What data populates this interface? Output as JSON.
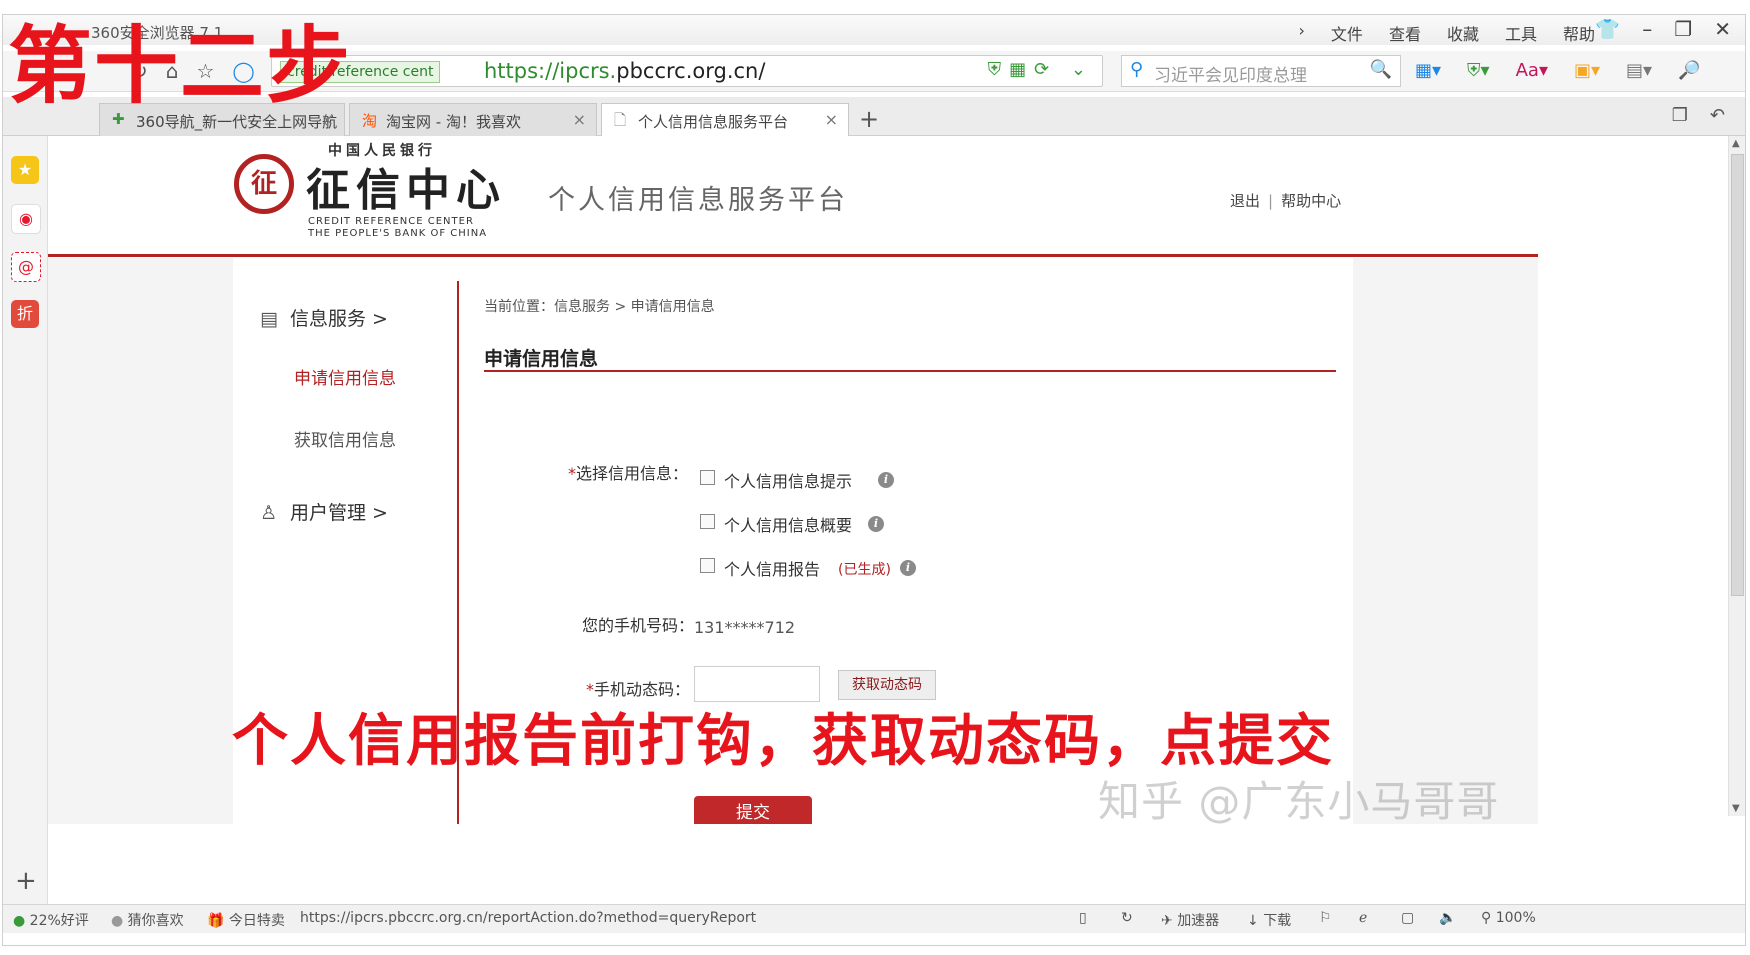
{
  "browser": {
    "app_title": "360安全浏览器 7.1",
    "menu": [
      "文件",
      "查看",
      "收藏",
      "工具",
      "帮助"
    ],
    "site_badge": "credit reference cent",
    "url_scheme": "https://ipcrs.",
    "url_host": "pbccrc.org.cn/",
    "search_placeholder": "习近平会见印度总理",
    "tabs": [
      {
        "label": "360导航_新一代安全上网导航",
        "active": false
      },
      {
        "label": "淘宝网 - 淘！我喜欢",
        "active": false
      },
      {
        "label": "个人信用信息服务平台",
        "active": true
      }
    ],
    "status": {
      "rating": "22%好评",
      "guess": "猜你喜欢",
      "deals": "今日特卖",
      "link_url": "https://ipcrs.pbccrc.org.cn/reportAction.do?method=queryReport",
      "accelerator": "加速器",
      "download": "下载",
      "zoom": "100%"
    }
  },
  "header": {
    "logo_top": "中国人民银行",
    "logo_main": "征信中心",
    "logo_en_line1": "CREDIT REFERENCE CENTER",
    "logo_en_line2": "THE PEOPLE'S BANK OF CHINA",
    "platform_title": "个人信用信息服务平台",
    "logout": "退出",
    "help": "帮助中心"
  },
  "leftnav": {
    "info_service": "信息服务 >",
    "apply_credit": "申请信用信息",
    "get_credit": "获取信用信息",
    "user_manage": "用户管理 >"
  },
  "main": {
    "breadcrumb": "当前位置：信息服务 > 申请信用信息",
    "section_title": "申请信用信息",
    "select_label": "选择信用信息：",
    "options": [
      {
        "label": "个人信用信息提示",
        "checked": false
      },
      {
        "label": "个人信用信息概要",
        "checked": false
      },
      {
        "label": "个人信用报告",
        "checked": false,
        "status": "(已生成)"
      }
    ],
    "phone_label": "您的手机号码：",
    "phone_value": "131*****712",
    "code_label": "手机动态码：",
    "code_value": "",
    "get_code_button": "获取动态码",
    "submit_button": "提交"
  },
  "overlay": {
    "step": "第十二步",
    "instruction": "个人信用报告前打钩，获取动态码，点提交",
    "watermark": "知乎 @广东小马哥哥"
  },
  "colors": {
    "brand_red": "#b22222",
    "overlay_red": "#e8141c",
    "submit_red": "#c0282a"
  }
}
